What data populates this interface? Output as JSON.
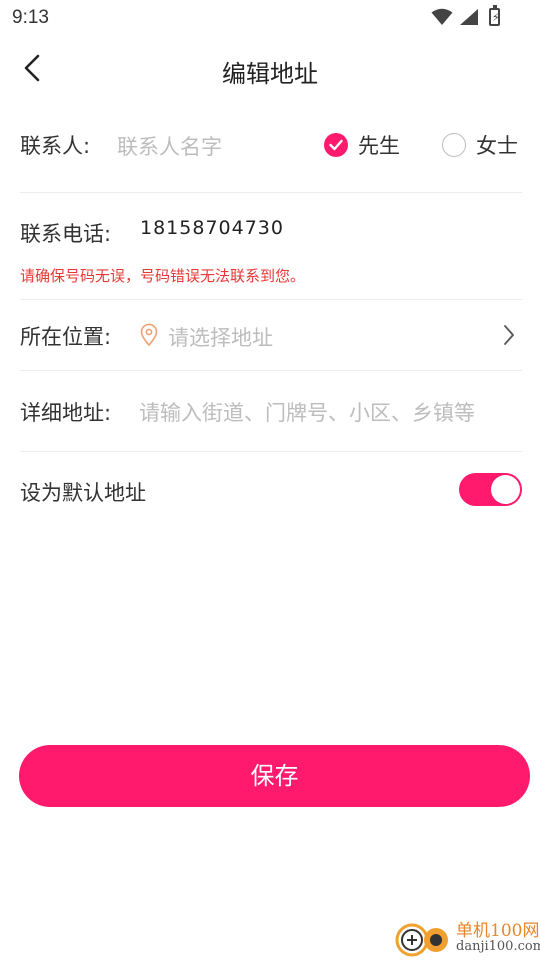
{
  "status_bar": {
    "time": "9:13",
    "icons": [
      "wifi-icon",
      "signal-icon",
      "battery-charging-icon"
    ]
  },
  "header": {
    "title": "编辑地址",
    "back_icon": "chevron-left-icon"
  },
  "form": {
    "contact": {
      "label": "联系人:",
      "placeholder": "联系人名字",
      "options": [
        {
          "label": "先生",
          "selected": true
        },
        {
          "label": "女士",
          "selected": false
        }
      ]
    },
    "phone": {
      "label": "联系电话:",
      "value": "18158704730",
      "error": "请确保号码无误，号码错误无法联系到您。"
    },
    "location": {
      "label": "所在位置:",
      "placeholder": "请选择地址",
      "icon": "location-pin-icon"
    },
    "detail": {
      "label": "详细地址:",
      "placeholder": "请输入街道、门牌号、小区、乡镇等"
    },
    "default_address": {
      "label": "设为默认地址",
      "enabled": true
    }
  },
  "save_button": {
    "label": "保存"
  },
  "watermark": {
    "name": "单机100网",
    "url": "danji100.com"
  },
  "colors": {
    "accent": "#ff1a6d",
    "error": "#e53935",
    "placeholder": "#bdbdbd",
    "pin": "#f0a070"
  }
}
